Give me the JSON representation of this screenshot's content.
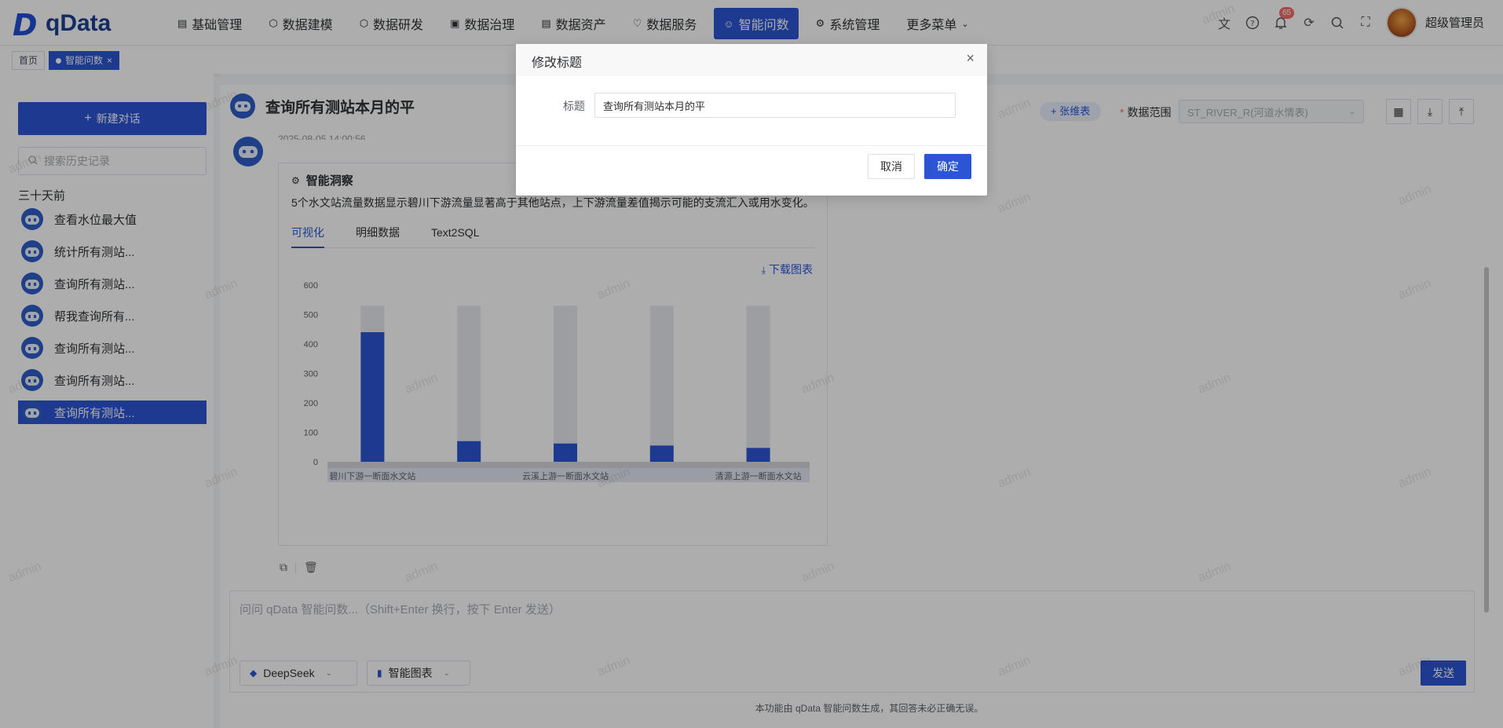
{
  "app": {
    "logo_text": "qData"
  },
  "nav": [
    {
      "label": "基础管理",
      "icon": "doc-icon",
      "glyph": "▤"
    },
    {
      "label": "数据建模",
      "icon": "cube-icon",
      "glyph": "⬡"
    },
    {
      "label": "数据研发",
      "icon": "hexagon-icon",
      "glyph": "⬡"
    },
    {
      "label": "数据治理",
      "icon": "shield-icon",
      "glyph": "▣"
    },
    {
      "label": "数据资产",
      "icon": "asset-icon",
      "glyph": "▤"
    },
    {
      "label": "数据服务",
      "icon": "heart-icon",
      "glyph": "♡"
    },
    {
      "label": "智能问数",
      "icon": "robot-icon",
      "glyph": "☺"
    },
    {
      "label": "系统管理",
      "icon": "gear-icon",
      "glyph": "⚙"
    },
    {
      "label": "更多菜单",
      "icon": "",
      "glyph": ""
    }
  ],
  "header": {
    "notification_count": "65",
    "username": "超级管理员"
  },
  "tabs": {
    "home": "首页",
    "current": "智能问数"
  },
  "sidebar": {
    "new_chat": "新建对话",
    "search_placeholder": "搜索历史记录",
    "group_label": "三十天前",
    "items": [
      {
        "label": "查看水位最大值"
      },
      {
        "label": "统计所有测站..."
      },
      {
        "label": "查询所有测站..."
      },
      {
        "label": "帮我查询所有..."
      },
      {
        "label": "查询所有测站..."
      },
      {
        "label": "查询所有测站..."
      },
      {
        "label": "查询所有测站..."
      }
    ]
  },
  "conversation": {
    "title": "查询所有测站本月的平",
    "timestamp": "2025-08-05 14:00:56",
    "add_table": "+ 张维表",
    "range_label": "数据范围",
    "range_value": "ST_RIVER_R(河道水情表)"
  },
  "answer": {
    "insight_title": "智能洞察",
    "insight_text": "5个水文站流量数据显示碧川下游流量显著高于其他站点，上下游流量差值揭示可能的支流汇入或用水变化。",
    "tabs": [
      "可视化",
      "明细数据",
      "Text2SQL"
    ],
    "download": "下载图表"
  },
  "chart_data": {
    "type": "bar",
    "categories": [
      "碧川下游一断面水文站",
      "",
      "云溪上游一断面水文站",
      "",
      "清源上游一断面水文站"
    ],
    "values": [
      440,
      70,
      62,
      55,
      47
    ],
    "background_max": 530,
    "ylim": [
      0,
      600
    ],
    "yticks": [
      0,
      100,
      200,
      300,
      400,
      500,
      600
    ],
    "tick_labels": [
      "碧川下游一断面水文站",
      "云溪上游一断面水文站",
      "清源上游一断面水文站"
    ],
    "colors": {
      "bar": "#2b55d4",
      "bg_bar": "#e6e9ef"
    }
  },
  "input": {
    "placeholder": "问问 qData 智能问数...（Shift+Enter 换行，按下 Enter 发送）",
    "model": "DeepSeek",
    "chart_mode": "智能图表",
    "send": "发送"
  },
  "disclaimer": "本功能由 qData 智能问数生成，其回答未必正确无误。",
  "watermark": "admin",
  "dialog": {
    "title": "修改标题",
    "field_label": "标题",
    "field_value": "查询所有测站本月的平",
    "cancel": "取消",
    "confirm": "确定"
  },
  "colors": {
    "primary": "#2b55d4",
    "badge": "#f56c6c"
  }
}
